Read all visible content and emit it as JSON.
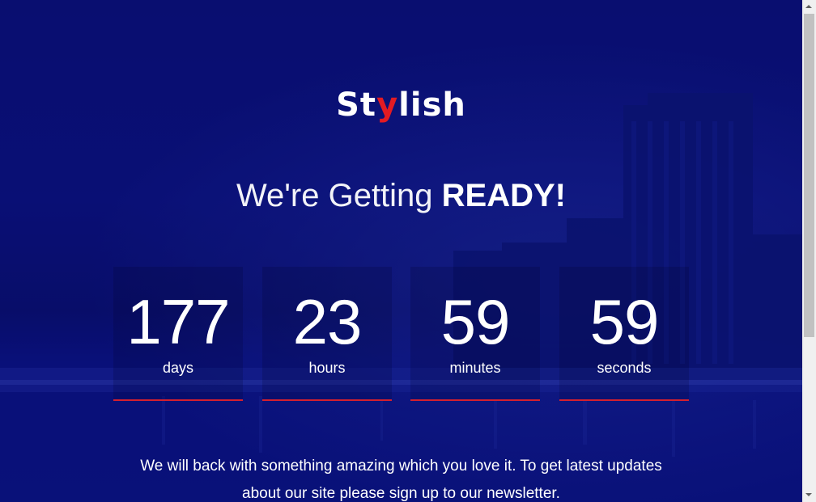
{
  "logo": {
    "part1": "St",
    "part2": "y",
    "part3": "lish"
  },
  "headline": {
    "light": "We're Getting ",
    "bold": "READY!"
  },
  "countdown": [
    {
      "value": "177",
      "label": "days"
    },
    {
      "value": "23",
      "label": "hours"
    },
    {
      "value": "59",
      "label": "minutes"
    },
    {
      "value": "59",
      "label": "seconds"
    }
  ],
  "message": {
    "line1": "We will back with something amazing which you love it. To get latest updates",
    "line2": "about our site please sign up to our newsletter."
  },
  "colors": {
    "accent": "#e31b23",
    "background": "#0b1272"
  }
}
